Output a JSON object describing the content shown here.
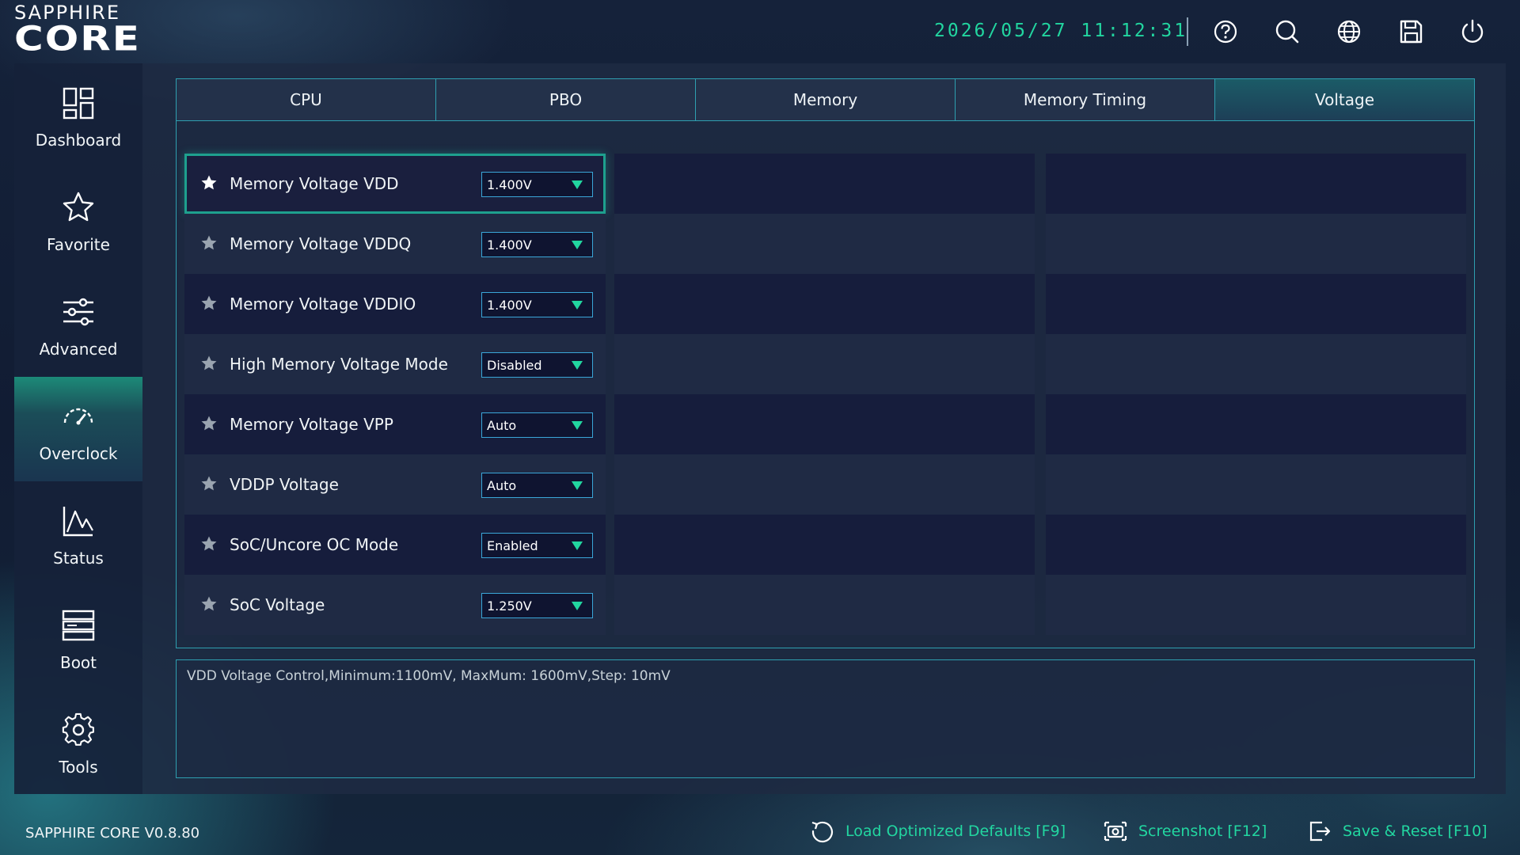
{
  "app": {
    "brand_top": "SAPPHIRE",
    "brand_big": "CORE",
    "datetime": "2026/05/27 11:12:31",
    "version": "SAPPHIRE CORE V0.8.80"
  },
  "header_icons": [
    "help-icon",
    "search-icon",
    "globe-icon",
    "save-icon",
    "power-icon"
  ],
  "sidebar": {
    "items": [
      {
        "label": "Dashboard",
        "icon": "dashboard-icon"
      },
      {
        "label": "Favorite",
        "icon": "star-icon"
      },
      {
        "label": "Advanced",
        "icon": "sliders-icon"
      },
      {
        "label": "Overclock",
        "icon": "speedometer-icon",
        "active": true
      },
      {
        "label": "Status",
        "icon": "chart-icon"
      },
      {
        "label": "Boot",
        "icon": "boot-icon"
      },
      {
        "label": "Tools",
        "icon": "gear-icon"
      }
    ]
  },
  "tabs": [
    {
      "label": "CPU"
    },
    {
      "label": "PBO"
    },
    {
      "label": "Memory"
    },
    {
      "label": "Memory Timing"
    },
    {
      "label": "Voltage",
      "active": true
    }
  ],
  "settings": [
    {
      "name": "Memory Voltage VDD",
      "value": "1.400V",
      "selected": true
    },
    {
      "name": "Memory Voltage VDDQ",
      "value": "1.400V"
    },
    {
      "name": "Memory Voltage VDDIO",
      "value": "1.400V"
    },
    {
      "name": "High Memory Voltage Mode",
      "value": "Disabled"
    },
    {
      "name": "Memory Voltage VPP",
      "value": "Auto"
    },
    {
      "name": "VDDP Voltage",
      "value": "Auto"
    },
    {
      "name": "SoC/Uncore OC Mode",
      "value": "Enabled"
    },
    {
      "name": "SoC Voltage",
      "value": "1.250V"
    }
  ],
  "help_text": "VDD Voltage Control,Minimum:1100mV, MaxMum: 1600mV,Step: 10mV",
  "footer": {
    "load_defaults": "Load Optimized Defaults [F9]",
    "screenshot": "Screenshot [F12]",
    "save_reset": "Save & Reset [F10]"
  },
  "colors": {
    "accent": "#22d6a0",
    "border": "#2e9fb0",
    "select_border": "#3aa6d8"
  }
}
